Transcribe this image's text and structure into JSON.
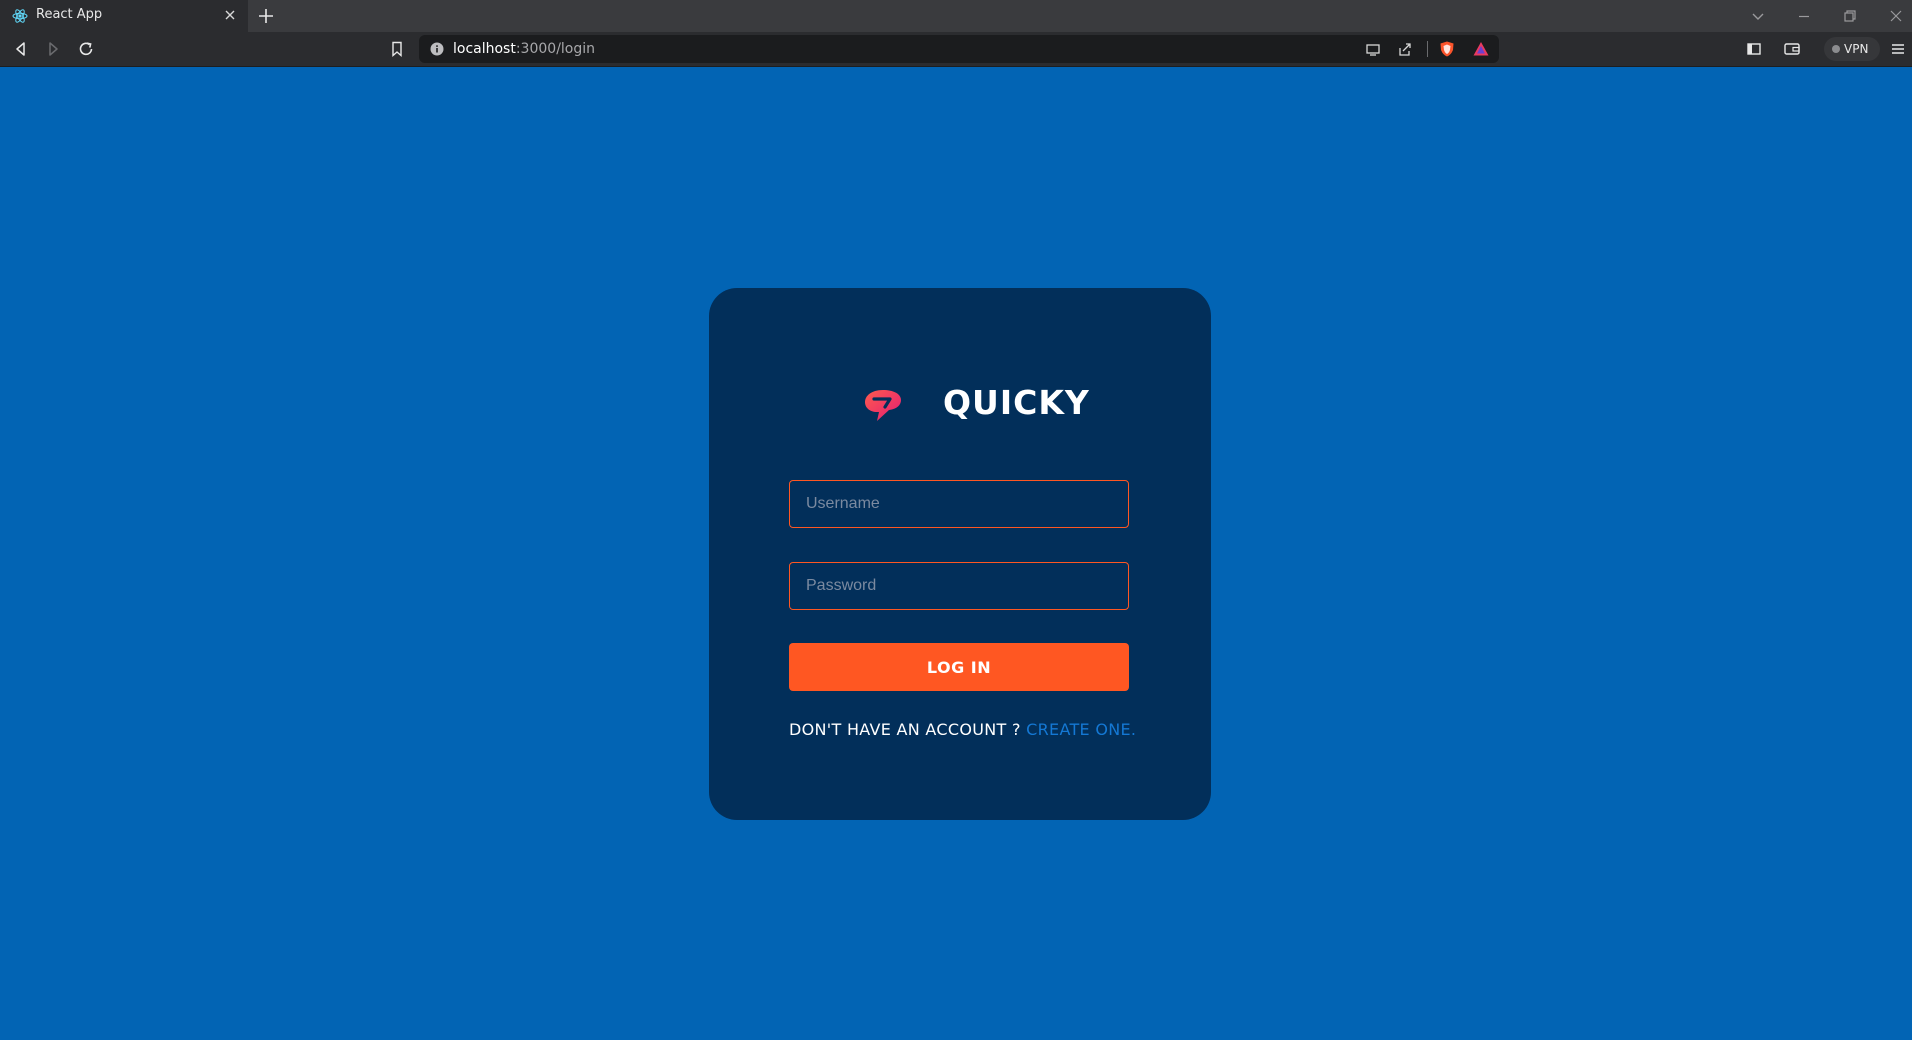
{
  "browser": {
    "tab_title": "React App",
    "url_host": "localhost",
    "url_path": ":3000/login",
    "vpn_label": "VPN"
  },
  "login": {
    "brand": "QUICKY",
    "username_placeholder": "Username",
    "password_placeholder": "Password",
    "login_label": "LOG IN",
    "signup_prompt": "DON'T HAVE AN ACCOUNT ?",
    "signup_link": "CREATE ONE."
  },
  "colors": {
    "page_background": "#0264b4",
    "card_background": "#022f5a",
    "accent": "#ff5722",
    "link": "#1478d4",
    "logo_gradient": [
      "#ff5a4e",
      "#e11d74"
    ]
  },
  "icons": [
    "react-icon",
    "close-icon",
    "plus-icon",
    "chevron-down-icon",
    "minimize-icon",
    "restore-icon",
    "window-close-icon",
    "back-icon",
    "forward-icon",
    "reload-icon",
    "bookmark-icon",
    "info-icon",
    "cast-icon",
    "share-icon",
    "brave-shield-icon",
    "brave-rewards-icon",
    "sidebar-icon",
    "wallet-icon",
    "menu-icon",
    "quicky-logo-icon"
  ]
}
